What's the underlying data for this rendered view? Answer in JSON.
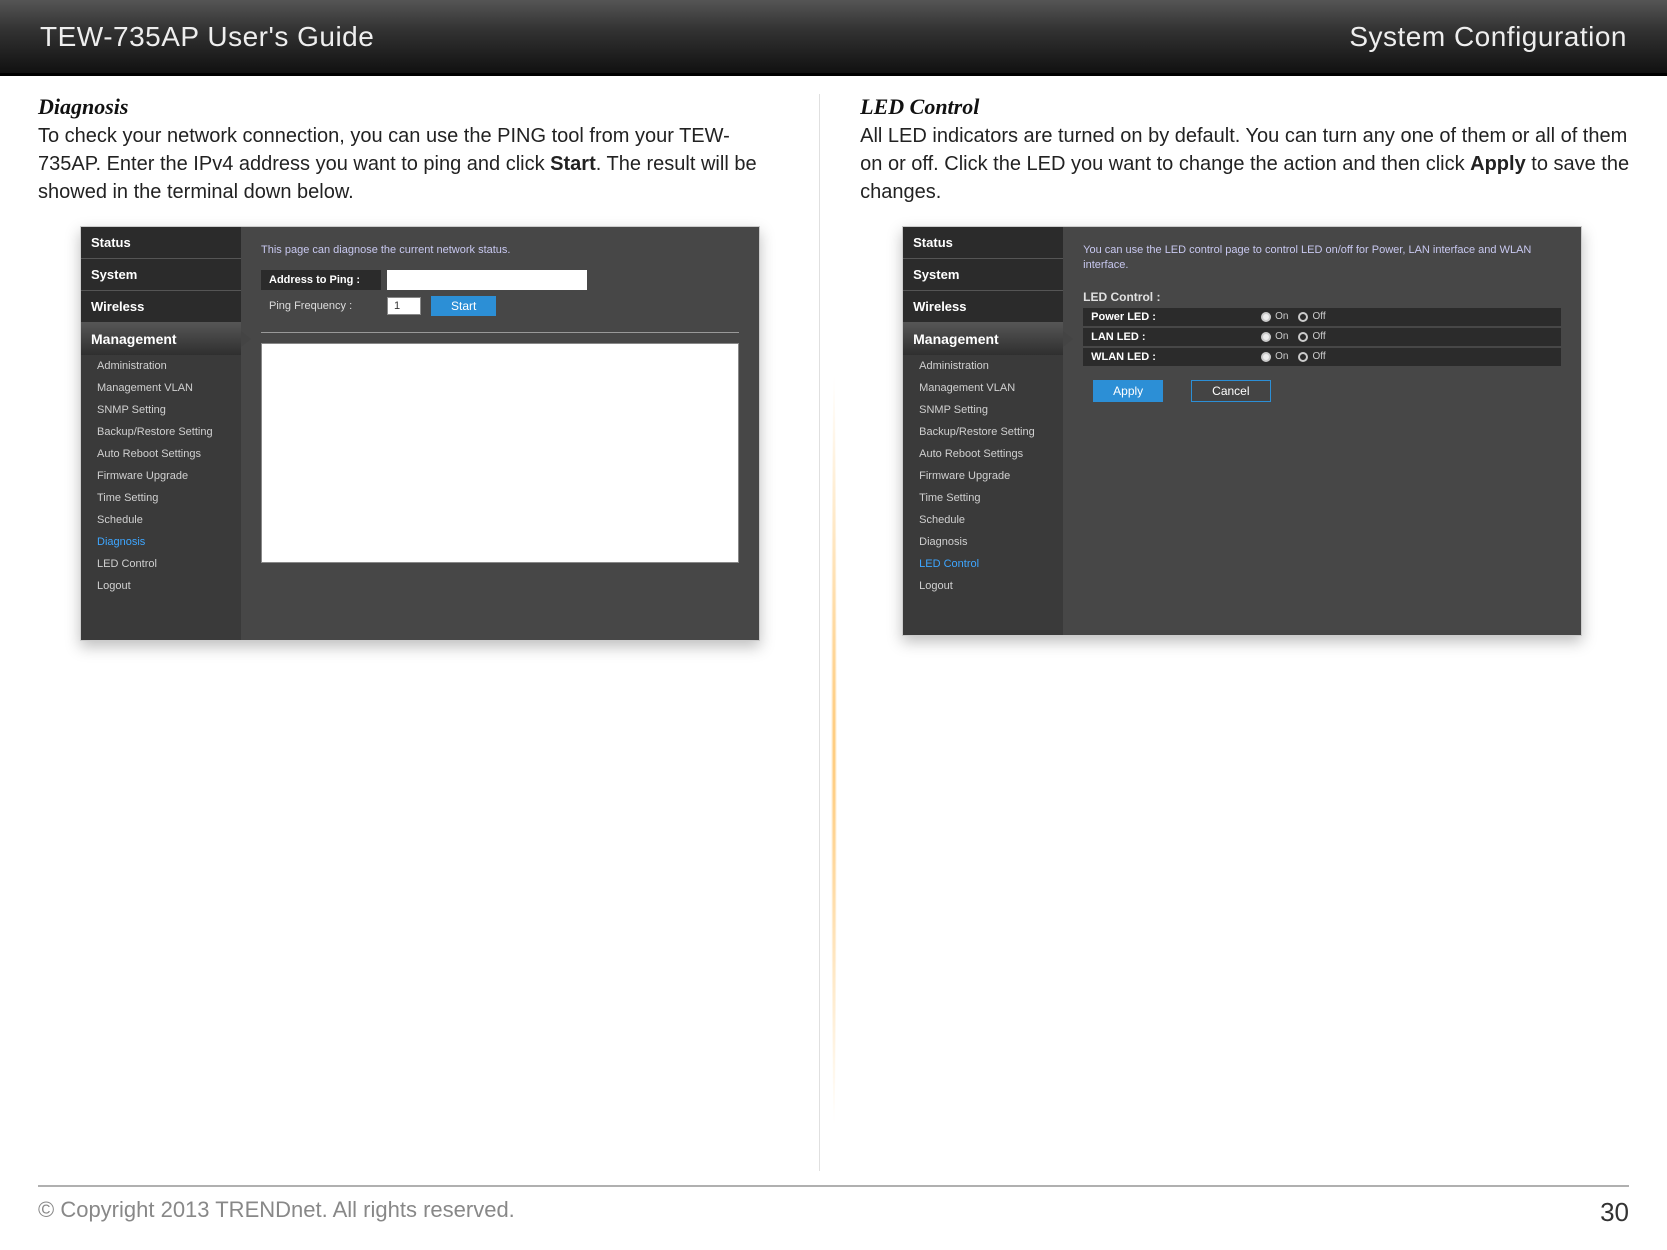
{
  "header": {
    "left": "TEW-735AP User's Guide",
    "right": "System Configuration"
  },
  "left_col": {
    "title": "Diagnosis",
    "desc_parts": [
      "To check your network connection, you can use the PING tool from your TEW-735AP. Enter the IPv4 address you want to ping and click ",
      "Start",
      ". The result will be showed in the terminal down below."
    ],
    "screenshot": {
      "sidebar": {
        "headers": [
          "Status",
          "System",
          "Wireless"
        ],
        "expanded": "Management",
        "subs": [
          "Administration",
          "Management VLAN",
          "SNMP Setting",
          "Backup/Restore Setting",
          "Auto Reboot Settings",
          "Firmware Upgrade",
          "Time Setting",
          "Schedule",
          "Diagnosis",
          "LED Control",
          "Logout"
        ],
        "active": "Diagnosis"
      },
      "desc": "This page can diagnose the current network status.",
      "address_label": "Address to Ping :",
      "freq_label": "Ping Frequency :",
      "freq_value": "1",
      "start_btn": "Start"
    }
  },
  "right_col": {
    "title": "LED Control",
    "desc_parts": [
      "All LED indicators are turned on by default. You can turn any one of them or all of them on or off. Click the LED you want to change the action and then click ",
      "Apply",
      " to save the changes."
    ],
    "screenshot": {
      "sidebar": {
        "headers": [
          "Status",
          "System",
          "Wireless"
        ],
        "expanded": "Management",
        "subs": [
          "Administration",
          "Management VLAN",
          "SNMP Setting",
          "Backup/Restore Setting",
          "Auto Reboot Settings",
          "Firmware Upgrade",
          "Time Setting",
          "Schedule",
          "Diagnosis",
          "LED Control",
          "Logout"
        ],
        "active": "LED Control"
      },
      "desc": "You can use the LED control page to control LED on/off for Power, LAN interface and WLAN interface.",
      "section_h": "LED Control :",
      "rows": [
        {
          "label": "Power LED :",
          "on": "On",
          "off": "Off"
        },
        {
          "label": "LAN LED :",
          "on": "On",
          "off": "Off"
        },
        {
          "label": "WLAN LED :",
          "on": "On",
          "off": "Off"
        }
      ],
      "apply_btn": "Apply",
      "cancel_btn": "Cancel"
    }
  },
  "footer": {
    "copyright": "© Copyright 2013 TRENDnet. All rights reserved.",
    "page": "30"
  }
}
